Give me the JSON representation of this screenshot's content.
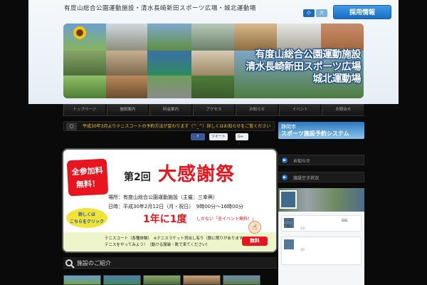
{
  "header": {
    "tagline": "有度山総合公園運動施設・清水長崎新田スポーツ広場・城北運動場",
    "font_size_small": "小",
    "font_size_large": "大",
    "recruit_label": "採用情報",
    "accent_color": "#1a6cc4"
  },
  "banner": {
    "title_lines": [
      "有度山総合公園運動施設",
      "清水長崎新田スポーツ広場",
      "城北運動場"
    ]
  },
  "nav": {
    "items": [
      "トップページ",
      "施設案内",
      "料金案内",
      "アクセス",
      "お知らせ",
      "イベント",
      "お問合せ"
    ]
  },
  "news": {
    "icon": "speech-bubble-icon",
    "text": "平成30年3月よりテニスコートの予約方法が変わります（^_^）詳しくはお知らせをご覧ください"
  },
  "share": {
    "facebook_label": "シェア",
    "twitter_label": "ツイート",
    "googleplus_label": "G+ 0"
  },
  "reservation": {
    "line1": "静岡市",
    "line2": "スポーツ施設予約システム"
  },
  "poster": {
    "free_line1": "全参加料",
    "free_line2": "無料！",
    "round": "第2回",
    "title": "大感謝祭",
    "venue": "場所：有度山総合公園運動施設（主催：三幸興）",
    "date": "日時：平成30年2月12日（月・祝日）　9時00分～16時00分",
    "detail_line1": "詳しくは",
    "detail_line2": "こちらをクリック",
    "once": "1年に1度",
    "once_note": "しかない「全イベント無料！」",
    "tennis_line1": "テニスコート（各種体験）　※テニスラケット貸出し有り（数に限りがあります）",
    "tennis_line2": "テニスをやってみよう！（動ける服装・靴で来てください）",
    "free_tag": "無料",
    "title_color": "#e8141e"
  },
  "sidebar": {
    "button1_label": "お知らせ",
    "button2_label": "施設空き状況",
    "fb_date": "2/10",
    "fb_gg": "GG",
    "fb_tbg": "TBG",
    "fb_count1": "10",
    "fb_count2": "10"
  },
  "section": {
    "title": "施設のご紹介",
    "icon": "search-icon"
  }
}
